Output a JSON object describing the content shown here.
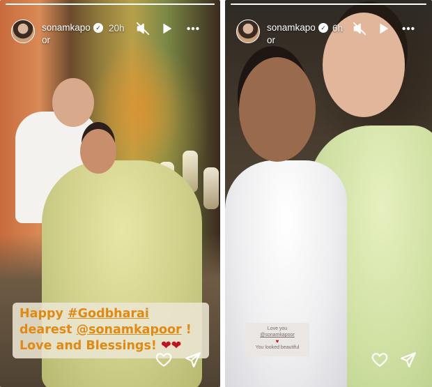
{
  "stories": [
    {
      "username": "sonamkapoor",
      "timestamp": "20h",
      "progress_fraction": 1.0,
      "caption": {
        "line1_prefix": "Happy ",
        "hashtag": "#Godbharai",
        "line2_prefix": "dearest ",
        "mention": "@sonamkapoor",
        "line2_suffix": " !",
        "line3": "Love and Blessings! ",
        "hearts": "❤❤"
      }
    },
    {
      "username": "sonamkapoor",
      "timestamp": "6h",
      "progress_fraction": 1.0,
      "note": {
        "line1": "Love you",
        "mention": "@sonamkapoor",
        "heart": "♥",
        "line3": "You looked beautiful"
      }
    }
  ],
  "icons": {
    "verified": "verified-badge-icon",
    "mute": "speaker-muted-icon",
    "play": "play-icon",
    "more": "more-options-icon",
    "like": "heart-outline-icon",
    "share": "send-icon"
  },
  "colors": {
    "caption_text": "#e08a14",
    "caption_bg": "#ebe6d2",
    "heart_red": "#c0141e"
  }
}
